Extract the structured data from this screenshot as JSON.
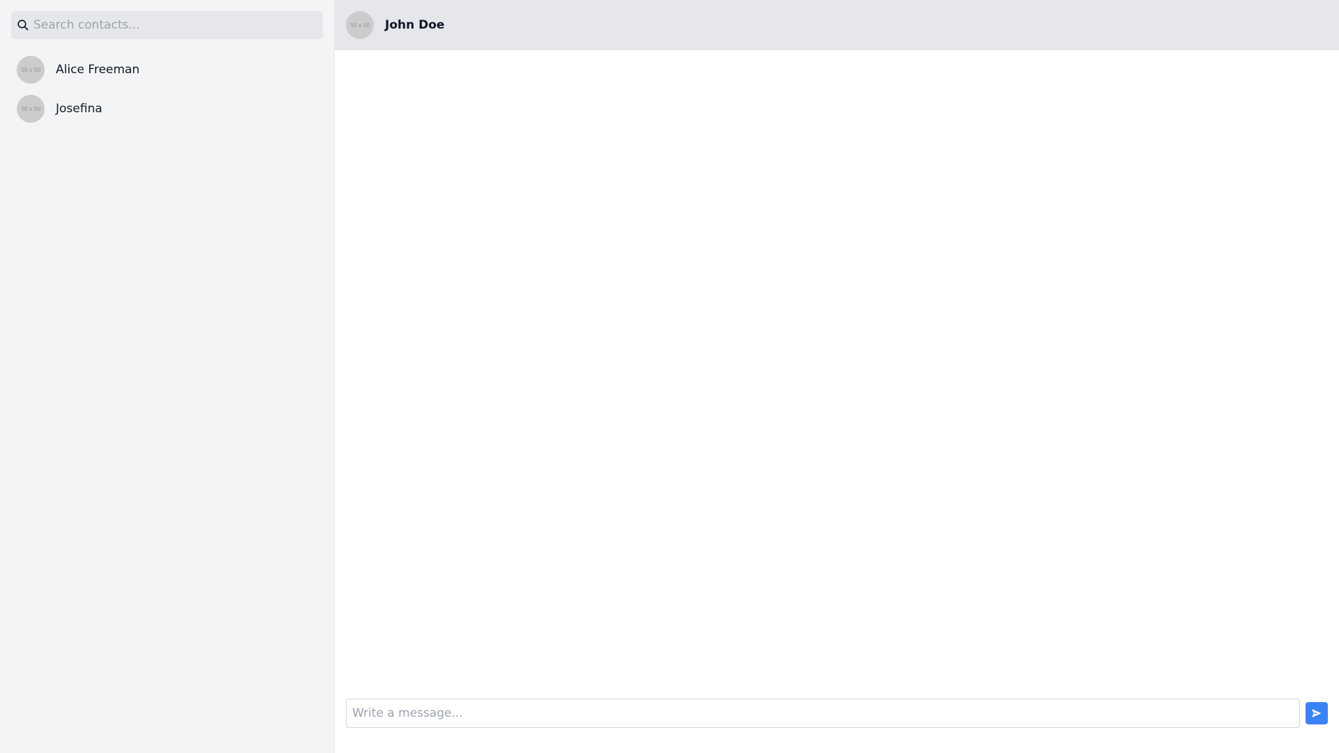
{
  "search": {
    "placeholder": "Search contacts..."
  },
  "contacts": [
    {
      "name": "Alice Freeman",
      "avatar_text": "50 x 50"
    },
    {
      "name": "Josefina",
      "avatar_text": "50 x 50"
    }
  ],
  "chat": {
    "contact_name": "John Doe",
    "avatar_text": "50 x 50"
  },
  "composer": {
    "placeholder": "Write a message..."
  },
  "icons": {
    "search": "search-icon",
    "send": "send-icon"
  },
  "colors": {
    "sidebar_bg": "#f3f4f6",
    "header_bg": "#e5e7eb",
    "accent": "#3b82f6",
    "avatar_placeholder": "#cccccc"
  }
}
